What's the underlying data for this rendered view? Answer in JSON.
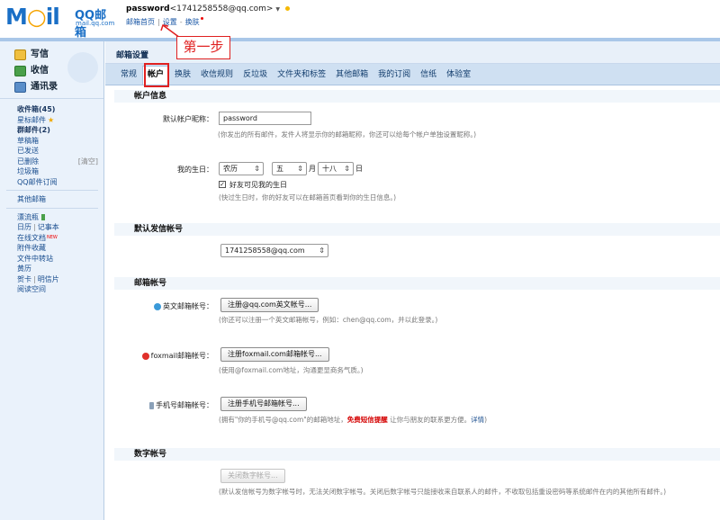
{
  "header": {
    "logo_main": "M",
    "logo_rest": "il",
    "logo_qq": "QQ邮箱",
    "logo_url": "mail.qq.com",
    "user_name": "password",
    "user_email": "<1741258558@qq.com>",
    "dropdown_glyph": "▼",
    "links": [
      "邮箱首页",
      "设置",
      "换肤"
    ]
  },
  "annotation": {
    "label": "第一步"
  },
  "sidebar": {
    "actions": [
      "写信",
      "收信",
      "通讯录"
    ],
    "folders": [
      {
        "label": "收件箱(45)",
        "bold": true
      },
      {
        "label": "星标邮件"
      },
      {
        "label": "群邮件(2)",
        "bold": true
      },
      {
        "label": "草稿箱"
      },
      {
        "label": "已发送"
      },
      {
        "label": "已删除",
        "extra": "[清空]"
      },
      {
        "label": "垃圾箱"
      },
      {
        "label": "QQ邮件订阅"
      }
    ],
    "other_box": "其他邮箱",
    "apps": {
      "drift_bottle": "漂流瓶",
      "calendar": "日历",
      "notepad": "记事本",
      "online_docs": "在线文档",
      "new_badge": "NEW",
      "attachments": "附件收藏",
      "file_transfer": "文件中转站",
      "almanac": "黄历",
      "greeting_card": "贺卡",
      "postcard": "明信片",
      "reading": "阅读空间"
    }
  },
  "main": {
    "title": "邮箱设置",
    "tabs": [
      "常规",
      "帐户",
      "换肤",
      "收信规则",
      "反垃圾",
      "文件夹和标签",
      "其他邮箱",
      "我的订阅",
      "信纸",
      "体验室"
    ],
    "active_tab": 1
  },
  "account_info": {
    "section_title": "帐户信息",
    "nickname_label": "默认帐户昵称：",
    "nickname_value": "password",
    "nickname_hint": "(你发出的所有邮件，发件人将显示你的邮箱昵称，你还可以给每个帐户单独设置昵称。)",
    "birthday_label": "我的生日：",
    "calendar_type": "农历",
    "month": "五",
    "month_unit": "月",
    "day": "十八",
    "day_unit": "日",
    "friends_visible_label": "好友可见我的生日",
    "friends_visible_checked": true,
    "birthday_hint": "(快过生日时，你的好友可以在邮箱首页看到你的生日信息。)"
  },
  "default_sender": {
    "section_title": "默认发信帐号",
    "value": "1741258558@qq.com"
  },
  "mail_accounts": {
    "section_title": "邮箱帐号",
    "english_label": "英文邮箱帐号：",
    "english_button": "注册@qq.com英文帐号...",
    "english_hint": "(你还可以注册一个英文邮箱帐号，例如：chen@qq.com，并以此登录。)",
    "foxmail_label": "foxmail邮箱帐号：",
    "foxmail_button": "注册foxmail.com邮箱帐号...",
    "foxmail_hint": "(使用@foxmail.com地址，沟通更显商务气质。)",
    "mobile_label": "手机号邮箱帐号：",
    "mobile_button": "注册手机号邮箱帐号...",
    "mobile_hint_prefix": "(拥有\"你的手机号@qq.com\"的邮箱地址，",
    "mobile_hint_red": "免费短信提醒",
    "mobile_hint_mid": " 让你与朋友的联系更方便。",
    "mobile_hint_link": "详情",
    "mobile_hint_suffix": ")"
  },
  "digit_account": {
    "section_title": "数字帐号",
    "button": "关闭数字帐号...",
    "hint": "(默认发信帐号为数字帐号时，无法关闭数字帐号。关闭后数字帐号只能接收来自联系人的邮件，不收取包括重设密码等系统邮件在内的其他所有邮件。)"
  },
  "colors": {
    "brand_blue": "#1a6fc6",
    "annotation_red": "#e02020",
    "tab_bar": "#cfe0f2",
    "sidebar_bg": "#eaf2fb"
  }
}
